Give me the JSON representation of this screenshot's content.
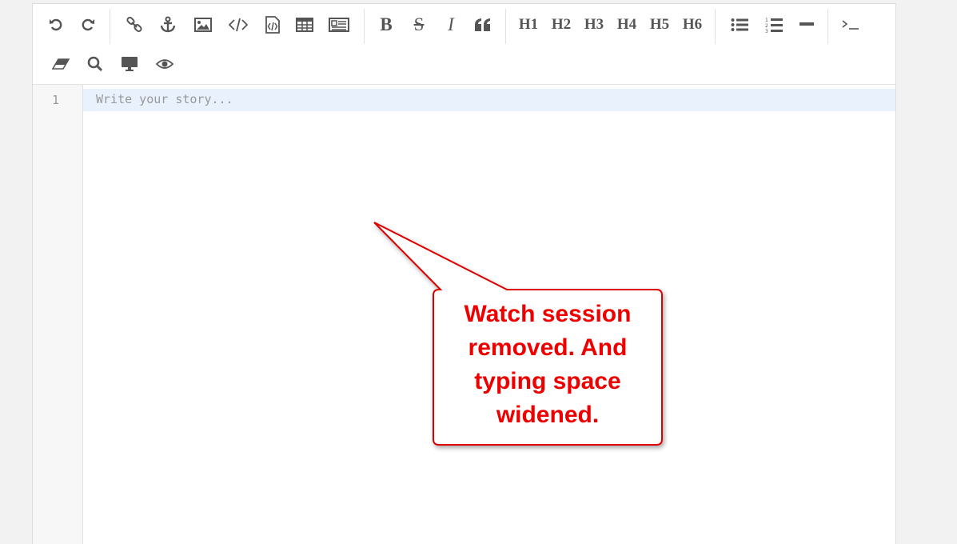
{
  "editor": {
    "toolbar": {
      "undo": "undo-icon",
      "redo": "redo-icon",
      "link": "link-icon",
      "anchor": "anchor-icon",
      "image": "image-icon",
      "code": "code-icon",
      "code_file": "code-file-icon",
      "table": "table-icon",
      "layout": "layout-icon",
      "bold_label": "B",
      "strike_label": "S",
      "italic_label": "I",
      "quote": "quote-icon",
      "h1_label": "H1",
      "h2_label": "H2",
      "h3_label": "H3",
      "h4_label": "H4",
      "h5_label": "H5",
      "h6_label": "H6",
      "bullet_list": "unordered-list-icon",
      "number_list": "ordered-list-icon",
      "hr": "horizontal-rule-icon",
      "terminal": "terminal-icon",
      "eraser": "eraser-icon",
      "search": "search-icon",
      "fullscreen": "desktop-icon",
      "preview": "eye-icon"
    },
    "line_number": "1",
    "placeholder": "Write your story..."
  },
  "annotation": {
    "line1": "Watch session",
    "line2": "removed. And",
    "line3": "typing space",
    "line4": "widened.",
    "color": "#ee0000"
  }
}
